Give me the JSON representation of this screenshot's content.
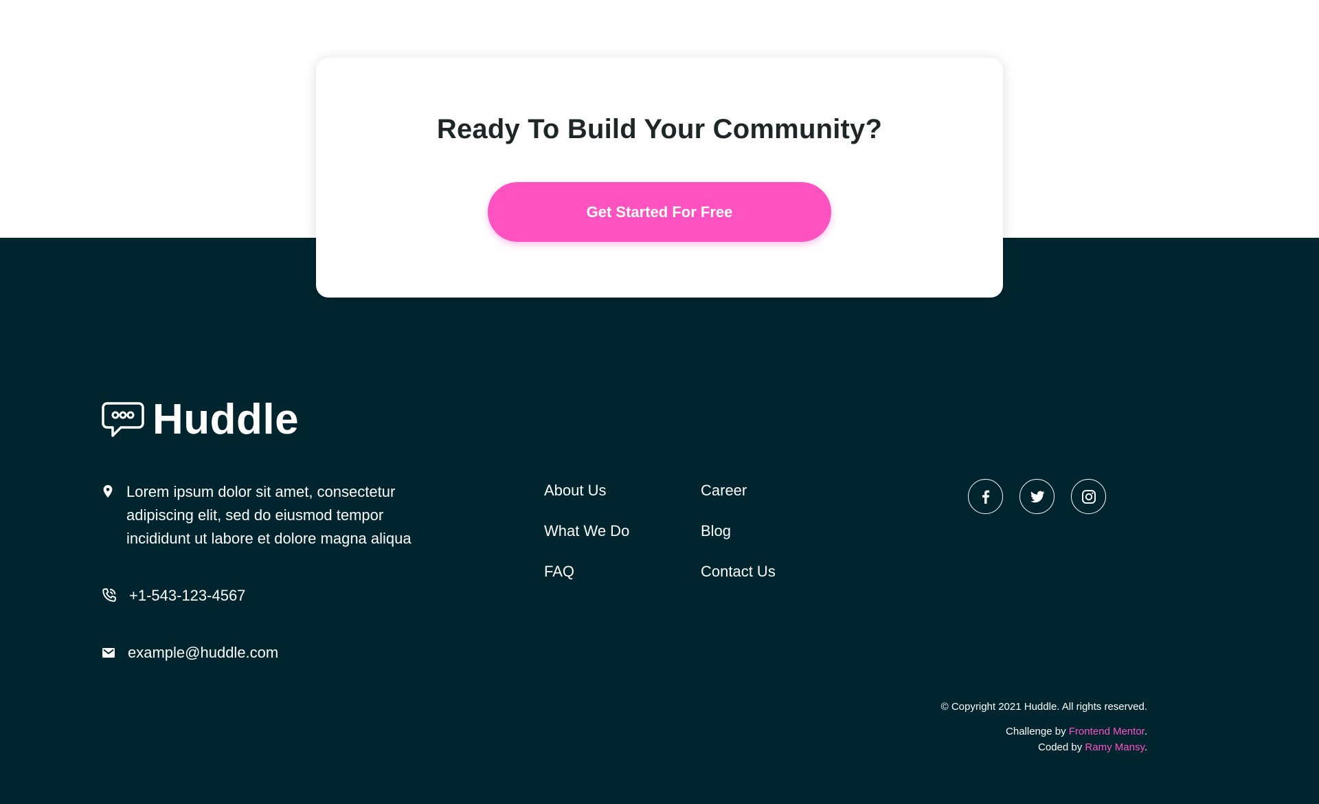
{
  "cta": {
    "title": "Ready To Build Your Community?",
    "button_label": "Get Started For Free"
  },
  "brand": {
    "name": "Huddle",
    "logo_icon": "chat-bubble-icon"
  },
  "contact": {
    "address": "Lorem ipsum dolor sit amet, consectetur adipiscing elit, sed do eiusmod tempor incididunt ut labore et dolore magna aliqua",
    "phone": "+1-543-123-4567",
    "email": "example@huddle.com"
  },
  "nav": {
    "column1": [
      "About Us",
      "What We Do",
      "FAQ"
    ],
    "column2": [
      "Career",
      "Blog",
      "Contact Us"
    ]
  },
  "social": [
    {
      "name": "facebook-icon"
    },
    {
      "name": "twitter-icon"
    },
    {
      "name": "instagram-icon"
    }
  ],
  "footer": {
    "copyright": "© Copyright 2021 Huddle. All rights reserved.",
    "challenge_prefix": "Challenge by ",
    "challenge_link": "Frontend Mentor",
    "coded_prefix": "Coded by ",
    "coded_link": "Ramy Mansy",
    "period": "."
  },
  "colors": {
    "footer_bg": "#00252e",
    "accent_pink": "#ff52c1",
    "heading": "#1f2628",
    "text_on_dark": "#ffffff"
  }
}
